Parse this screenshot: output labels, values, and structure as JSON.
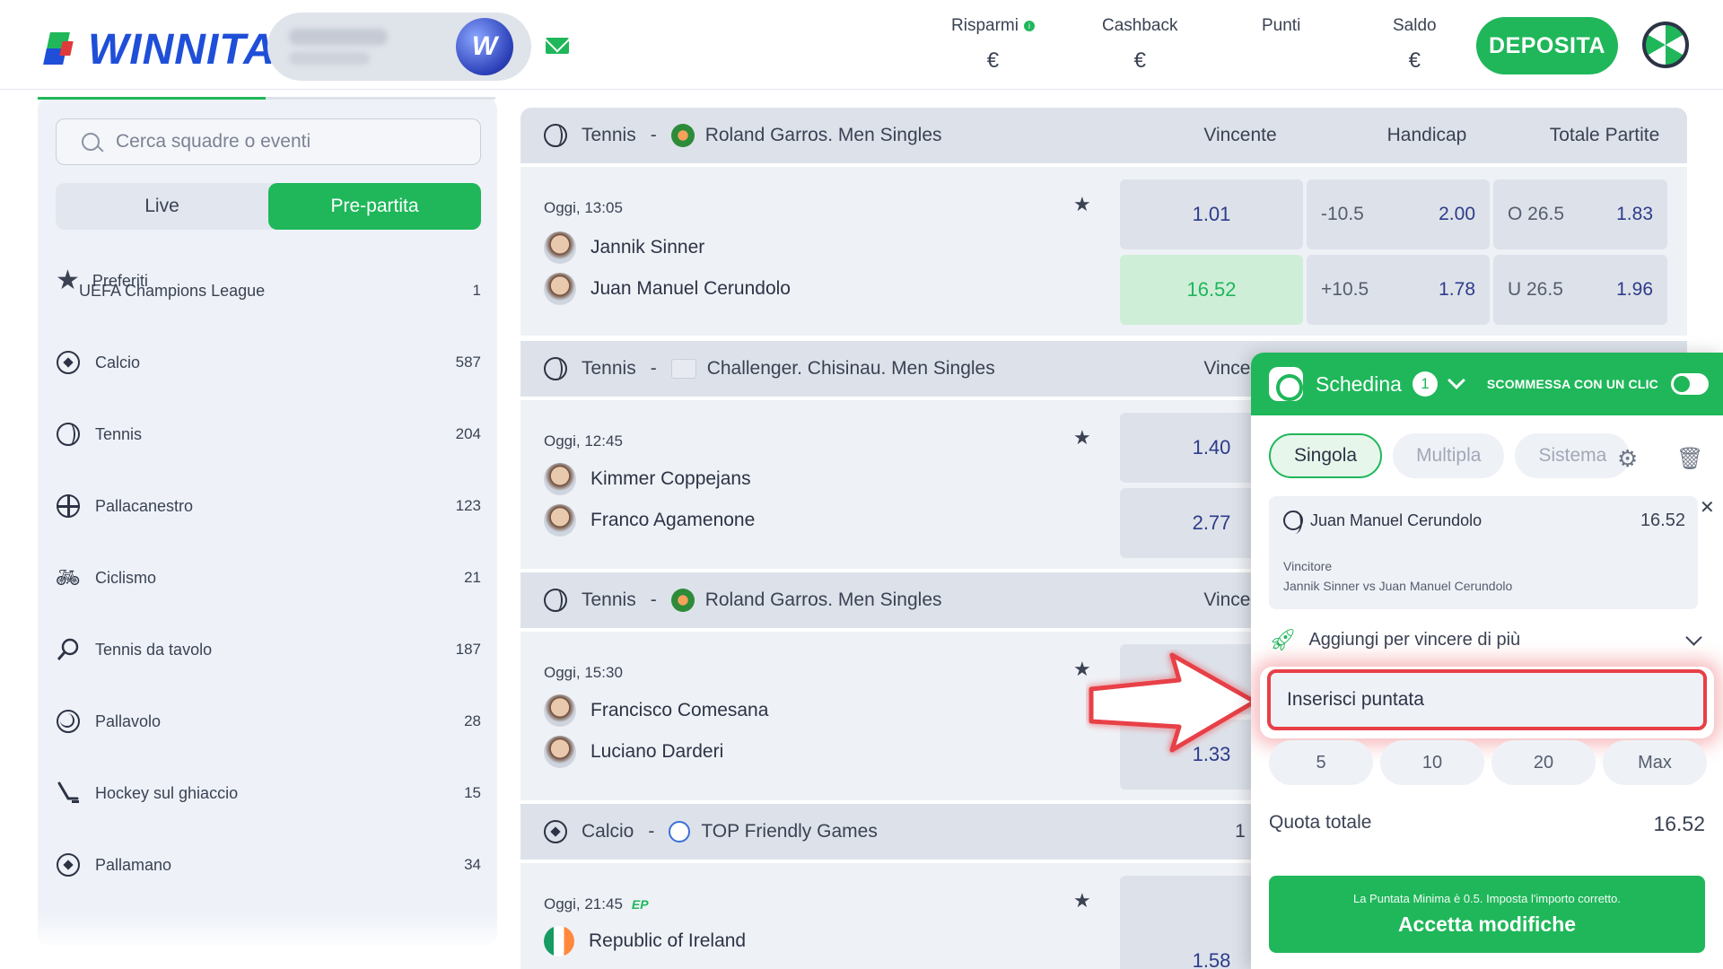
{
  "header": {
    "logo_text": "WINNITA",
    "badge_letter": "W",
    "stats": [
      {
        "label": "Risparmi",
        "value": "€"
      },
      {
        "label": "Cashback",
        "value": "€"
      },
      {
        "label": "Punti",
        "value": ""
      },
      {
        "label": "Saldo",
        "value": "€"
      }
    ],
    "deposit_label": "DEPOSITA"
  },
  "sidebar": {
    "search_placeholder": "Cerca squadre o eventi",
    "mode_tabs": [
      "Live",
      "Pre-partita"
    ],
    "favorites_label": "Preferiti",
    "items": [
      {
        "label": "UEFA Champions League",
        "count": "1",
        "icon": "none"
      },
      {
        "label": "Calcio",
        "count": "587",
        "icon": "soccer-ball-icon"
      },
      {
        "label": "Tennis",
        "count": "204",
        "icon": "tennis-ball-icon"
      },
      {
        "label": "Pallacanestro",
        "count": "123",
        "icon": "basketball-icon"
      },
      {
        "label": "Ciclismo",
        "count": "21",
        "icon": "bicycle-icon"
      },
      {
        "label": "Tennis da tavolo",
        "count": "187",
        "icon": "table-tennis-icon"
      },
      {
        "label": "Pallavolo",
        "count": "28",
        "icon": "volleyball-icon"
      },
      {
        "label": "Hockey sul ghiaccio",
        "count": "15",
        "icon": "hockey-stick-icon"
      },
      {
        "label": "Pallamano",
        "count": "34",
        "icon": "handball-icon"
      }
    ]
  },
  "board": {
    "col_headers": [
      "Vincente",
      "Handicap",
      "Totale Partite"
    ],
    "sections": [
      {
        "sport": "Tennis",
        "sep": "-",
        "league": "Roland Garros. Men Singles",
        "event": {
          "time": "Oggi, 13:05",
          "players": [
            "Jannik Sinner",
            "Juan Manuel Cerundolo"
          ],
          "winner": [
            "1.01",
            "16.52"
          ],
          "handicap": [
            [
              "-10.5",
              "2.00"
            ],
            [
              "+10.5",
              "1.78"
            ]
          ],
          "totals": [
            [
              "O 26.5",
              "1.83"
            ],
            [
              "U 26.5",
              "1.96"
            ]
          ]
        }
      },
      {
        "sport": "Tennis",
        "sep": "-",
        "league": "Challenger. Chisinau. Men Singles",
        "col": "Vincente",
        "event": {
          "time": "Oggi, 12:45",
          "players": [
            "Kimmer Coppejans",
            "Franco Agamenone"
          ],
          "winner": [
            "1.40",
            "2.77"
          ]
        }
      },
      {
        "sport": "Tennis",
        "sep": "-",
        "league": "Roland Garros. Men Singles",
        "col": "Vincente",
        "event": {
          "time": "Oggi, 15:30",
          "players": [
            "Francisco Comesana",
            "Luciano Darderi"
          ],
          "winner": [
            "",
            "1.33"
          ]
        }
      },
      {
        "sport": "Calcio",
        "sep": "-",
        "league": "TOP Friendly Games",
        "col": "1",
        "event": {
          "time": "Oggi, 21:45",
          "tag": "EP",
          "players": [
            "Republic of Ireland"
          ],
          "winner": [
            "1.58"
          ]
        }
      }
    ]
  },
  "betslip": {
    "title": "Schedina",
    "count": "1",
    "one_click_label": "SCOMMESSA CON UN CLIC",
    "tabs": [
      "Singola",
      "Multipla",
      "Sistema"
    ],
    "selection": {
      "name": "Juan Manuel Cerundolo",
      "odd": "16.52",
      "market": "Vincitore",
      "match": "Jannik Sinner vs Juan Manuel Cerundolo"
    },
    "boost_label": "Aggiungi per vincere di più",
    "stake_placeholder": "Inserisci puntata",
    "quick_amounts": [
      "5",
      "10",
      "20",
      "Max"
    ],
    "total_label": "Quota totale",
    "total_value": "16.52",
    "min_stake_hint": "La Puntata Minima è 0.5. Imposta l'importo corretto.",
    "accept_label": "Accetta modifiche"
  },
  "colors": {
    "brand_green": "#1fb75a",
    "brand_blue": "#1f4fd8",
    "alert_red": "#e83f47",
    "odd_blue": "#2d3b8a"
  }
}
